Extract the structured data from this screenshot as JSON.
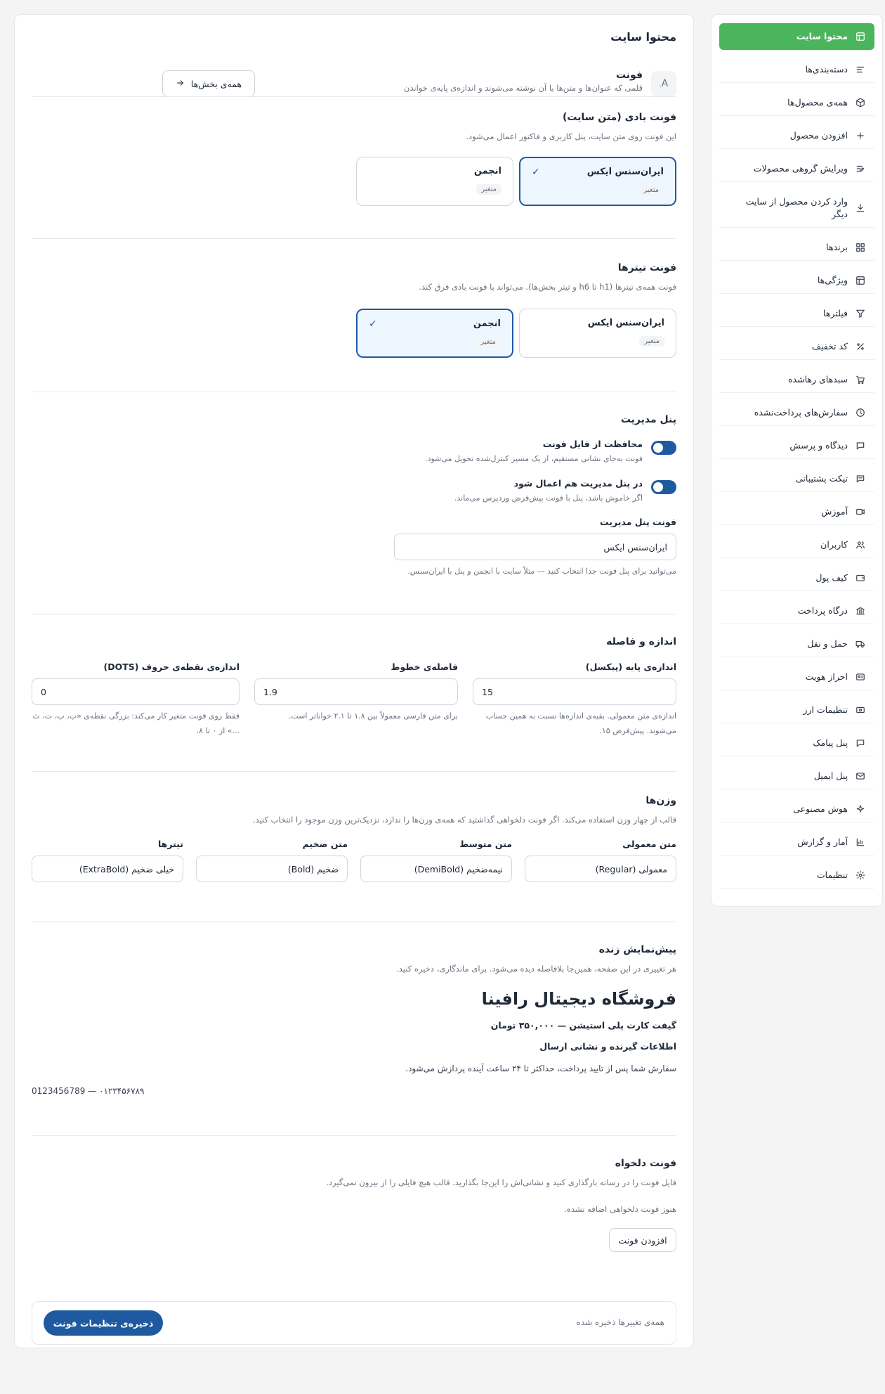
{
  "sidebar": {
    "items": [
      {
        "label": "محتوا سایت",
        "icon": "layout-icon",
        "active": true
      },
      {
        "label": "دسته‌بندی‌ها",
        "icon": "list-icon"
      },
      {
        "label": "همه‌ی محصول‌ها",
        "icon": "box-icon"
      },
      {
        "label": "افزودن محصول",
        "icon": "plus-icon"
      },
      {
        "label": "ویرایش گروهی محصولات",
        "icon": "bulk-edit-icon"
      },
      {
        "label": "وارد کردن محصول از سایت دیگر",
        "icon": "download-icon"
      },
      {
        "label": "برندها",
        "icon": "grid-icon"
      },
      {
        "label": "ویژگی‌ها",
        "icon": "layout-icon"
      },
      {
        "label": "فیلترها",
        "icon": "filter-icon"
      },
      {
        "label": "کد تخفیف",
        "icon": "percent-icon"
      },
      {
        "label": "سبدهای رهاشده",
        "icon": "cart-icon"
      },
      {
        "label": "سفارش‌های پرداخت‌نشده",
        "icon": "clock-icon"
      },
      {
        "label": "دیدگاه و پرسش",
        "icon": "comment-icon"
      },
      {
        "label": "تیکت پشتیبانی",
        "icon": "ticket-icon"
      },
      {
        "label": "آموزش",
        "icon": "video-icon"
      },
      {
        "label": "کاربران",
        "icon": "users-icon"
      },
      {
        "label": "کیف پول",
        "icon": "wallet-icon"
      },
      {
        "label": "درگاه پرداخت",
        "icon": "bank-icon"
      },
      {
        "label": "حمل و نقل",
        "icon": "truck-icon"
      },
      {
        "label": "احراز هویت",
        "icon": "id-card-icon"
      },
      {
        "label": "تنظیمات ارز",
        "icon": "currency-icon"
      },
      {
        "label": "پنل پیامک",
        "icon": "sms-icon"
      },
      {
        "label": "پنل ایمیل",
        "icon": "mail-icon"
      },
      {
        "label": "هوش مصنوعی",
        "icon": "sparkle-icon"
      },
      {
        "label": "آمار و گزارش",
        "icon": "chart-icon"
      },
      {
        "label": "تنظیمات",
        "icon": "gear-icon"
      }
    ]
  },
  "page": {
    "title": "محتوا سایت",
    "section_title": "فونت",
    "section_desc": "قلمی که عنوان‌ها و متن‌ها با آن نوشته می‌شوند و اندازه‌ی پایه‌ی خواندن",
    "badge": "A",
    "all_sections_btn": "همه‌ی بخش‌ها"
  },
  "body_font": {
    "title": "فونت بادی (متن سایت)",
    "desc": "این فونت روی متن سایت، پنل کاربری و فاکتور اعمال می‌شود.",
    "options": [
      {
        "name": "ایران‌سنس ایکس",
        "tag": "متغیر",
        "selected": true
      },
      {
        "name": "انجمن",
        "tag": "متغیر",
        "selected": false
      }
    ]
  },
  "title_font": {
    "title": "فونت تیترها",
    "desc": "فونت همه‌ی تیترها (h1 تا h6 و تیتر بخش‌ها). می‌تواند با فونت بادی فرق کند.",
    "options": [
      {
        "name": "ایران‌سنس ایکس",
        "tag": "متغیر",
        "selected": false
      },
      {
        "name": "انجمن",
        "tag": "متغیر",
        "selected": true
      }
    ]
  },
  "admin": {
    "title": "پنل مدیریت",
    "protect_title": "محافظت از فایل فونت",
    "protect_desc": "فونت به‌جای نشانی مستقیم، از یک مسیر کنترل‌شده تحویل می‌شود.",
    "apply_title": "در پنل مدیریت هم اعمال شود",
    "apply_desc": "اگر خاموش باشد، پنل با فونت پیش‌فرض وردپرس می‌ماند.",
    "font_label": "فونت پنل مدیریت",
    "font_value": "ایران‌سنس ایکس",
    "font_hint": "می‌توانید برای پنل فونت جدا انتخاب کنید — مثلاً سایت با انجمن و پنل با ایران‌سنس."
  },
  "sizing": {
    "title": "اندازه و فاصله",
    "base_label": "اندازه‌ی پایه (پیکسل)",
    "base_value": "15",
    "base_hint": "اندازه‌ی متن معمولی. بقیه‌ی اندازه‌ها نسبت به همین حساب می‌شوند. پیش‌فرض ۱۵.",
    "line_label": "فاصله‌ی خطوط",
    "line_value": "1.9",
    "line_hint": "برای متن فارسی معمولاً بین ۱.۸ تا ۲.۱ خواناتر است.",
    "dots_label": "اندازه‌ی نقطه‌ی حروف (DOTS)",
    "dots_value": "0",
    "dots_hint": "فقط روی فونت متغیر کار می‌کند: بزرگی نقطه‌ی «ب، پ، ت، ث ...» از ۰ تا ۸."
  },
  "weights": {
    "title": "وزن‌ها",
    "desc": "قالب از چهار وزن استفاده می‌کند. اگر فونت دلخواهی گذاشتید که همه‌ی وزن‌ها را ندارد، نزدیک‌ترین وزن موجود را انتخاب کنید.",
    "fields": [
      {
        "label": "متن معمولی",
        "value": "معمولی (Regular)"
      },
      {
        "label": "متن متوسط",
        "value": "نیمه‌ضخیم (DemiBold)"
      },
      {
        "label": "متن ضخیم",
        "value": "ضخیم (Bold)"
      },
      {
        "label": "تیترها",
        "value": "خیلی ضخیم (ExtraBold)"
      }
    ]
  },
  "preview": {
    "title": "پیش‌نمایش زنده",
    "desc": "هر تغییری در این صفحه، همین‌جا بلافاصله دیده می‌شود. برای ماندگاری، ذخیره کنید.",
    "store_name": "فروشگاه دیجیتال رافینا",
    "product": "گیفت کارت پلی استیشن — ۳۵۰,۰۰۰ تومان",
    "shipping": "اطلاعات گیرنده و نشانی ارسال",
    "order_msg": "سفارش شما پس از تایید پرداخت، حداکثر تا ۲۴ ساعت آینده پردازش می‌شود.",
    "numbers": "۰۱۲۳۴۵۶۷۸۹ — 0123456789"
  },
  "custom_font": {
    "title": "فونت دلخواه",
    "desc": "فایل فونت را در رسانه بارگذاری کنید و نشانی‌اش را این‌جا بگذارید. قالب هیچ فایلی را از بیرون نمی‌گیرد.",
    "empty": "هنوز فونت دلخواهی اضافه نشده.",
    "add_btn": "افزودن فونت"
  },
  "footer": {
    "status": "همه‌ی تغییرها ذخیره شده",
    "save_btn": "ذخیره‌ی تنظیمات فونت"
  },
  "colors": {
    "active_nav": "#4ab55c",
    "primary": "#1f5aa0"
  }
}
